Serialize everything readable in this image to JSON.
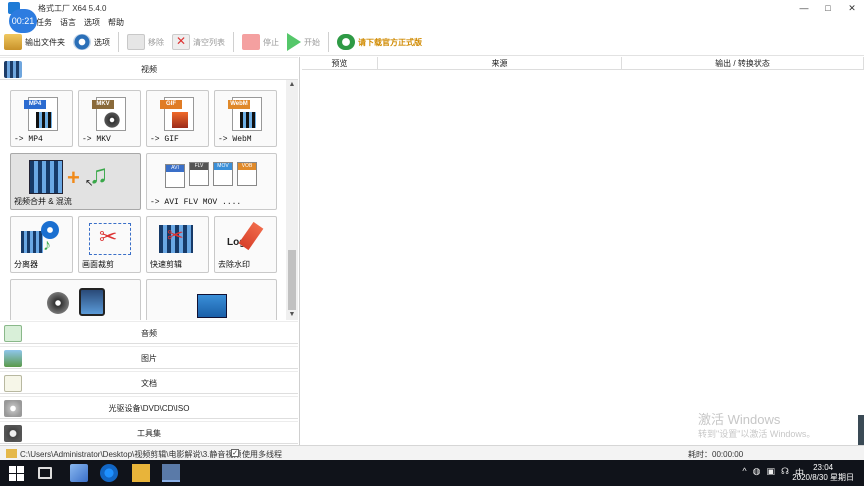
{
  "window": {
    "title": "格式工厂 X64 5.4.0",
    "timer": "00:21",
    "controls": [
      "—",
      "□",
      "✕"
    ]
  },
  "menu": {
    "items": [
      "任务",
      "语言",
      "选项",
      "帮助"
    ]
  },
  "toolbar": {
    "output_folder": "输出文件夹",
    "options": "选项",
    "remove": "移除",
    "clear_list": "清空列表",
    "stop": "停止",
    "start": "开始",
    "download": "请下载官方正式版"
  },
  "left_panel": {
    "categories": {
      "video": "视频",
      "audio": "音频",
      "image": "图片",
      "document": "文档",
      "disc": "光驱设备\\DVD\\CD\\ISO",
      "tools": "工具集"
    },
    "tiles": {
      "mp4": "-> MP4",
      "mkv": "-> MKV",
      "gif": "-> GIF",
      "webm": "-> WebM",
      "merge": "视频合并 & 混流",
      "avi_flv_mov": "-> AVI FLV MOV ....",
      "splitter": "分离器",
      "crop": "画面裁剪",
      "quick_clip": "快速剪辑",
      "remove_watermark": "去除水印"
    },
    "tags": {
      "mp4": "MP4",
      "mkv": "MKV",
      "gif": "GIF",
      "webm": "WebM",
      "avi": "AVI",
      "flv": "FLV",
      "mov": "MOV",
      "vob": "VOB",
      "logo": "Logo"
    }
  },
  "right_panel": {
    "columns": {
      "preview": "预览",
      "source": "来源",
      "output_status": "输出 / 转换状态"
    },
    "watermark_line1": "激活 Windows",
    "watermark_line2": "转到\"设置\"以激活 Windows。"
  },
  "statusbar": {
    "path": "C:\\Users\\Administrator\\Desktop\\视频剪辑\\电影解说\\3.静音视频",
    "multithread_checked": "✓",
    "multithread": "使用多线程",
    "elapsed": "耗时：00:00:00"
  },
  "taskbar": {
    "time": "23:04",
    "date": "2020/8/30 星期日",
    "ime": "中",
    "tray_icons": [
      "^",
      "◍",
      "▣",
      "☊",
      "中"
    ]
  },
  "colors": {
    "accent_blue": "#2d7ce0",
    "start_green": "#55c76a",
    "promo_orange": "#d08a00"
  }
}
